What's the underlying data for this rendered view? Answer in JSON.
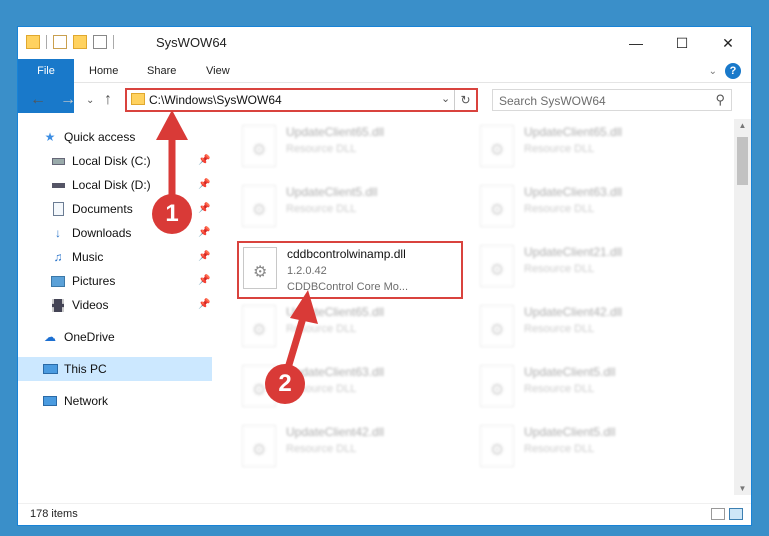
{
  "window": {
    "title": "SysWOW64"
  },
  "ribbon": {
    "tabs": [
      "File",
      "Home",
      "Share",
      "View"
    ],
    "help_label": "?"
  },
  "address": {
    "path": "C:\\Windows\\SysWOW64",
    "search_placeholder": "Search SysWOW64"
  },
  "sidebar": {
    "items": [
      {
        "label": "Quick access",
        "icon": "star-icon"
      },
      {
        "label": "Local Disk (C:)",
        "icon": "drive-icon"
      },
      {
        "label": "Local Disk (D:)",
        "icon": "drive-icon"
      },
      {
        "label": "Documents",
        "icon": "document-icon"
      },
      {
        "label": "Downloads",
        "icon": "download-icon"
      },
      {
        "label": "Music",
        "icon": "music-icon"
      },
      {
        "label": "Pictures",
        "icon": "pictures-icon"
      },
      {
        "label": "Videos",
        "icon": "video-icon"
      },
      {
        "label": "OneDrive",
        "icon": "cloud-icon"
      },
      {
        "label": "This PC",
        "icon": "computer-icon"
      },
      {
        "label": "Network",
        "icon": "network-icon"
      }
    ]
  },
  "files": {
    "left": [
      {
        "name": "UpdateClient65.dll",
        "type": "Resource DLL"
      },
      {
        "name": "UpdateClient5.dll",
        "type": "Resource DLL"
      },
      {
        "name": "cddbcontrolwinamp.dll",
        "version": "1.2.0.42",
        "desc": "CDDBControl Core Mo..."
      },
      {
        "name": "UpdateClient65.dll",
        "type": "Resource DLL"
      },
      {
        "name": "UpdateClient63.dll",
        "type": "Resource DLL"
      },
      {
        "name": "UpdateClient42.dll",
        "type": "Resource DLL"
      }
    ],
    "right": [
      {
        "name": "UpdateClient65.dll",
        "type": "Resource DLL"
      },
      {
        "name": "UpdateClient63.dll",
        "type": "Resource DLL"
      },
      {
        "name": "UpdateClient21.dll",
        "type": "Resource DLL"
      },
      {
        "name": "UpdateClient42.dll",
        "type": "Resource DLL"
      },
      {
        "name": "UpdateClient5.dll",
        "type": "Resource DLL"
      },
      {
        "name": "UpdateClient5.dll",
        "type": "Resource DLL"
      }
    ]
  },
  "status": {
    "item_count": "178 items"
  },
  "annotations": {
    "badge1": "1",
    "badge2": "2",
    "color": "#d93a37"
  }
}
